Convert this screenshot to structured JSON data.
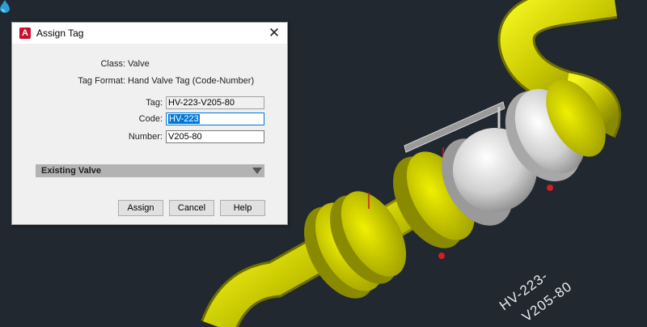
{
  "dialog": {
    "title": "Assign Tag",
    "class_label": "Class:",
    "class_value": "Valve",
    "tag_format_label": "Tag Format:",
    "tag_format_value": "Hand Valve Tag (Code-Number)",
    "tag_label": "Tag:",
    "tag_value": "HV-223-V205-80",
    "code_label": "Code:",
    "code_value": "HV-223",
    "number_label": "Number:",
    "number_value": "V205-80",
    "section_title": "Existing Valve",
    "buttons": {
      "assign": "Assign",
      "cancel": "Cancel",
      "help": "Help"
    }
  },
  "viewport": {
    "tag_label_line1": "HV-223-",
    "tag_label_line2": "V205-80"
  },
  "colors": {
    "background": "#212830",
    "pipe": "#d8d800",
    "valve_body": "#d4d4d4",
    "accent": "#0078d7"
  },
  "icons": {
    "app": "autocad-plant-icon",
    "close": "close-icon",
    "dropdown": "chevron-down-icon",
    "viewport": "water-drop-icon"
  }
}
